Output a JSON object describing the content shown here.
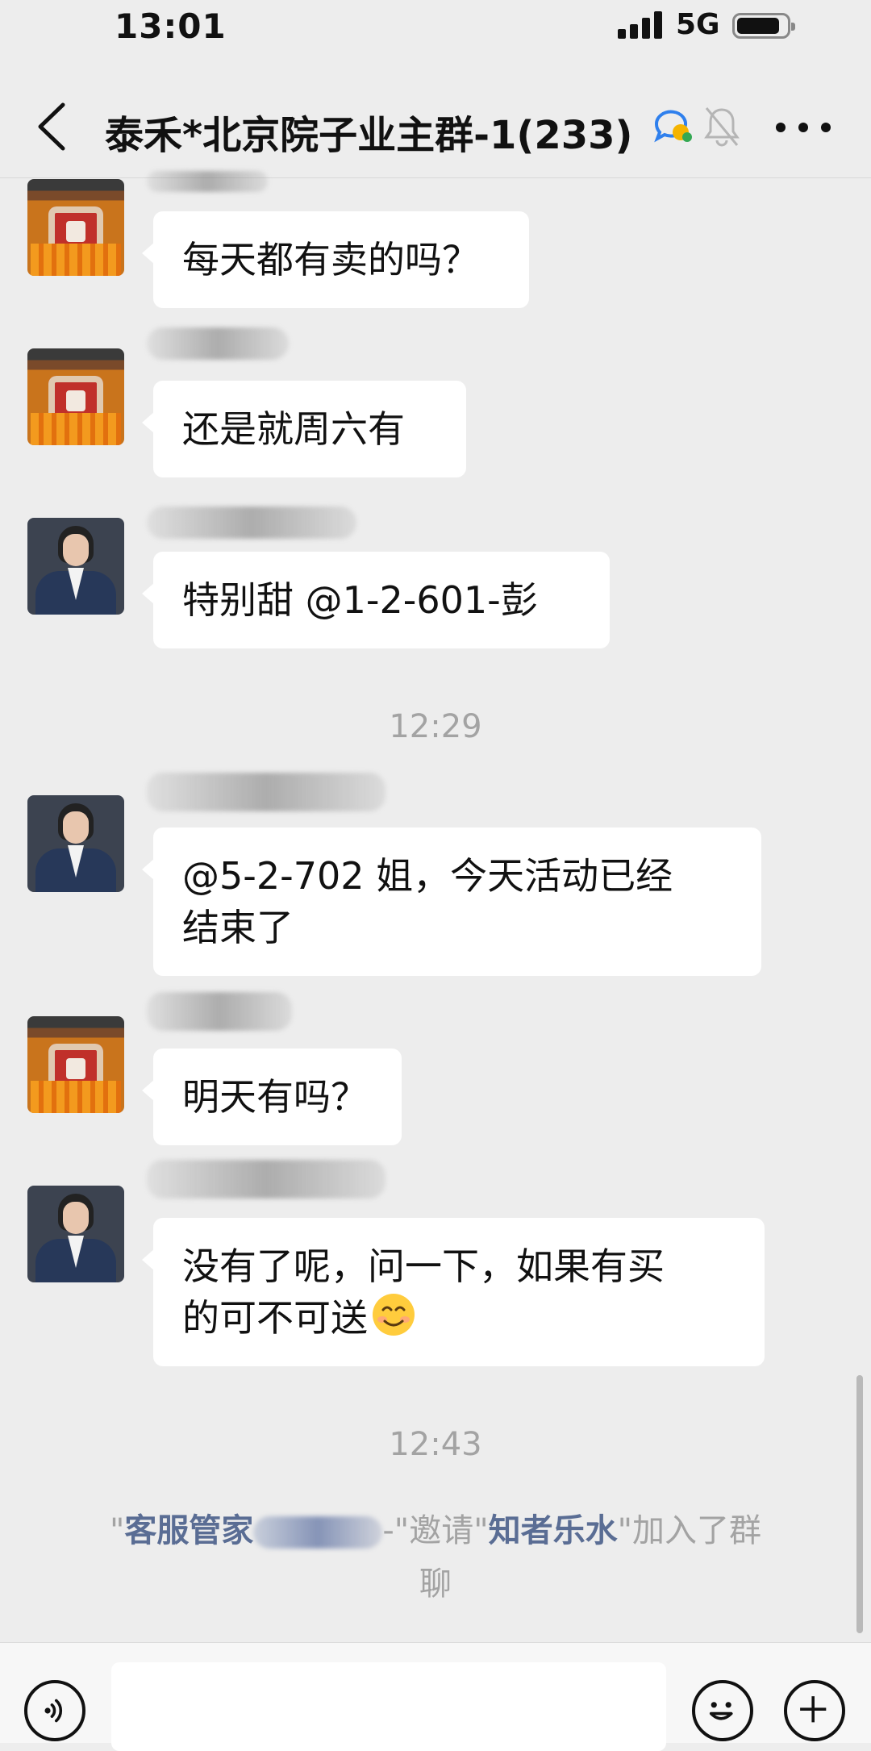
{
  "status_bar": {
    "time": "13:01",
    "network": "5G"
  },
  "nav": {
    "title": "泰禾*北京院子业主群-1(233)"
  },
  "messages": [
    {
      "text": "每天都有卖的吗？",
      "avatar": "lantern-avatar"
    },
    {
      "text": "还是就周六有",
      "avatar": "lantern-avatar"
    },
    {
      "text": "特别甜 @1-2-601-彭",
      "avatar": "person-avatar"
    },
    {
      "text_line1": "@5-2-702 姐，今天活动已经",
      "text_line2": "结束了",
      "avatar": "person-avatar"
    },
    {
      "text": "明天有吗？",
      "avatar": "lantern-avatar"
    },
    {
      "text_line1": "没有了呢，问一下，如果有买",
      "text_line2": "的可不可送",
      "avatar": "person-avatar",
      "emoji": "smiling-face"
    }
  ],
  "timestamps": [
    "12:29",
    "12:43"
  ],
  "system_notice": {
    "quote_open": "\"",
    "inviter": "客服管家",
    "suffix_after_inviter": "-\"邀请\"",
    "invitee": "知者乐水",
    "tail_line1": "\"加入了群",
    "tail_line2": "聊"
  },
  "icons": [
    "back-icon",
    "chat-bubble-icon",
    "mute-bell-icon",
    "more-icon",
    "voice-icon",
    "emoji-icon",
    "plus-icon"
  ],
  "colors": {
    "background": "#ededed",
    "bubble": "#ffffff",
    "link": "#5a6d94",
    "meta_text": "#a3a3a3"
  }
}
